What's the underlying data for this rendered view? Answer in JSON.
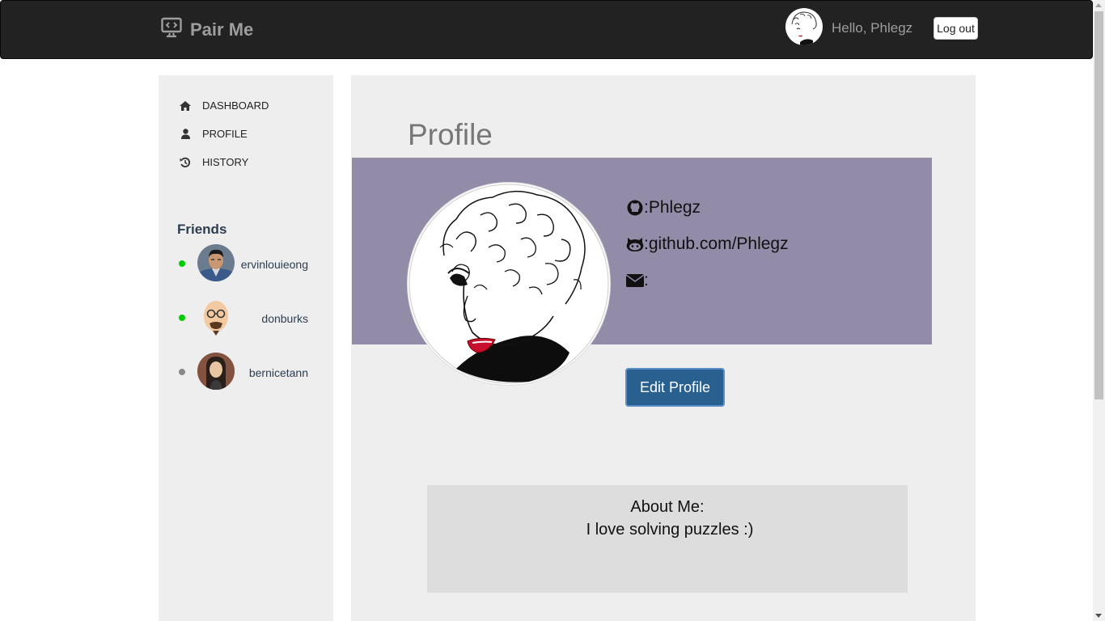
{
  "navbar": {
    "brand": "Pair Me",
    "greeting": "Hello, Phlegz",
    "logout_label": "Log out"
  },
  "sidebar": {
    "items": [
      {
        "label": "Dashboard",
        "icon": "home-icon"
      },
      {
        "label": "Profile",
        "icon": "user-icon"
      },
      {
        "label": "History",
        "icon": "history-icon"
      }
    ],
    "friends_heading": "Friends",
    "friends": [
      {
        "name": "ervinlouieong",
        "status_color": "#00cc00"
      },
      {
        "name": "donburks",
        "status_color": "#00cc00"
      },
      {
        "name": "bernicetann",
        "status_color": "#888888"
      }
    ]
  },
  "profile": {
    "title": "Profile",
    "username_separator": ": ",
    "username": "Phlegz",
    "github": "github.com/Phlegz",
    "email": "",
    "edit_button": "Edit Profile"
  },
  "about": {
    "title": "About Me:",
    "text": "I love solving puzzles :)"
  },
  "colors": {
    "navbar": "#222222",
    "banner": "#938ca9",
    "primary_button": "#286090",
    "panel": "#eeeeee"
  }
}
